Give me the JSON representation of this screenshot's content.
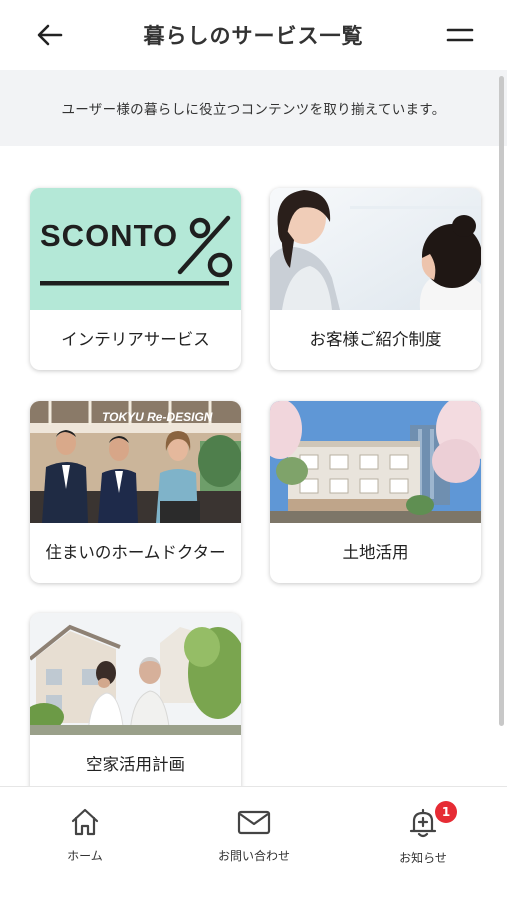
{
  "header": {
    "title": "暮らしのサービス一覧",
    "back_icon": "arrow-left-icon",
    "menu_icon": "menu-icon"
  },
  "subheader": {
    "text": "ユーザー様の暮らしに役立つコンテンツを取り揃えています。"
  },
  "services": [
    {
      "label": "インテリアサービス",
      "image": "sconto-logo"
    },
    {
      "label": "お客様ご紹介制度",
      "image": "two-women-photo"
    },
    {
      "label": "住まいのホームドクター",
      "image": "staff-photo",
      "image_text": "TOKYU Re-DESIGN"
    },
    {
      "label": "土地活用",
      "image": "apartment-photo"
    },
    {
      "label": "空家活用計画",
      "image": "elderly-couple-photo"
    }
  ],
  "sconto": {
    "logo_text": "SCONTO",
    "bg_color": "#b4e8d7"
  },
  "bottom_nav": [
    {
      "label": "ホーム",
      "icon": "home-icon"
    },
    {
      "label": "お問い合わせ",
      "icon": "mail-icon"
    },
    {
      "label": "お知らせ",
      "icon": "bell-icon",
      "badge": "1"
    }
  ],
  "colors": {
    "badge": "#e62b34",
    "subheader_bg": "#f2f3f5"
  }
}
